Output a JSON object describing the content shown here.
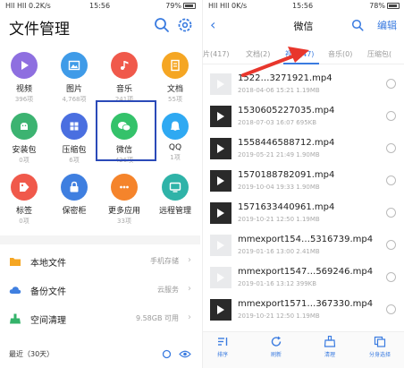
{
  "left": {
    "status": {
      "signal": "Hll Hll 0.2K/s",
      "time": "15:56",
      "battery": "79%"
    },
    "title": "文件管理",
    "grid": [
      {
        "label": "视频",
        "count": "396项",
        "color": "#8e6fe0"
      },
      {
        "label": "图片",
        "count": "4,768项",
        "color": "#3f9be8"
      },
      {
        "label": "音乐",
        "count": "241项",
        "color": "#f0594b"
      },
      {
        "label": "文档",
        "count": "55项",
        "color": "#f5a623"
      },
      {
        "label": "安装包",
        "count": "0项",
        "color": "#3cb371"
      },
      {
        "label": "压缩包",
        "count": "6项",
        "color": "#4a6fe0"
      },
      {
        "label": "微信",
        "count": "426项",
        "color": "#34c26a"
      },
      {
        "label": "QQ",
        "count": "1项",
        "color": "#2fa9f2"
      },
      {
        "label": "标签",
        "count": "0项",
        "color": "#f0594b"
      },
      {
        "label": "保密柜",
        "count": "",
        "color": "#3f7fe0"
      },
      {
        "label": "更多应用",
        "count": "33项",
        "color": "#f5842b"
      },
      {
        "label": "远程管理",
        "count": "",
        "color": "#2fb3a8"
      }
    ],
    "list": [
      {
        "label": "本地文件",
        "right": "手机存储",
        "color": "#f5a623"
      },
      {
        "label": "备份文件",
        "right": "云服务",
        "color": "#3f7fe0"
      },
      {
        "label": "空间清理",
        "right": "9.58GB 可用",
        "color": "#34b36a"
      }
    ],
    "recent": "最近（30天）"
  },
  "right": {
    "status": {
      "signal": "Hll Hll 0K/s",
      "time": "15:56",
      "battery": "78%"
    },
    "title": "微信",
    "edit": "编辑",
    "tabs": [
      {
        "label": "图片(417)",
        "active": false
      },
      {
        "label": "文档(2)",
        "active": false
      },
      {
        "label": "视频(47)",
        "active": true
      },
      {
        "label": "音乐(0)",
        "active": false
      },
      {
        "label": "压缩包(",
        "active": false
      }
    ],
    "videos": [
      {
        "name": "1522…3271921.mp4",
        "meta": "2018-04-06 15:21  1.19MB",
        "light": true
      },
      {
        "name": "1530605227035.mp4",
        "meta": "2018-07-03 16:07  695KB",
        "light": false
      },
      {
        "name": "1558446588712.mp4",
        "meta": "2019-05-21 21:49  1.90MB",
        "light": false
      },
      {
        "name": "1570188782091.mp4",
        "meta": "2019-10-04 19:33  1.90MB",
        "light": false
      },
      {
        "name": "1571633440961.mp4",
        "meta": "2019-10-21 12:50  1.19MB",
        "light": false
      },
      {
        "name": "mmexport154…5316739.mp4",
        "meta": "2019-01-16 13:00  2.41MB",
        "light": true
      },
      {
        "name": "mmexport1547…569246.mp4",
        "meta": "2019-01-16 13:12  399KB",
        "light": true
      },
      {
        "name": "mmexport1571…367330.mp4",
        "meta": "2019-10-21 12:50  1.19MB",
        "light": false
      }
    ],
    "bottom": [
      {
        "label": "排序",
        "icon": "sort-icon"
      },
      {
        "label": "刷新",
        "icon": "refresh-icon"
      },
      {
        "label": "清理",
        "icon": "clean-icon"
      },
      {
        "label": "分身选择",
        "icon": "clone-select-icon"
      }
    ],
    "accent": "#3a7be0"
  },
  "annotation": {
    "arrow_color": "#e8362c",
    "box_color": "#2b4ab8"
  }
}
